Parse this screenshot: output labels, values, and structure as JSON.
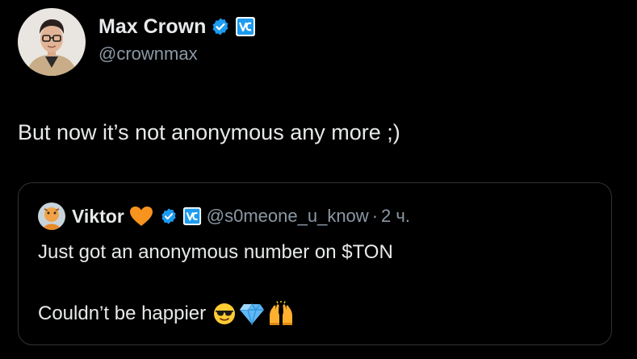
{
  "author": {
    "display_name": "Max Crown",
    "handle": "@crownmax",
    "avatar_icon": "profile-photo",
    "badges": [
      "verified-check-icon",
      "vc-badge-icon"
    ]
  },
  "tweet": {
    "text": "But now it’s not anonymous any more ;)"
  },
  "quoted": {
    "display_name": "Viktor",
    "handle": "@s0meone_u_know",
    "separator": "·",
    "time": "2 ч.",
    "line1": "Just got an anonymous number on $TON",
    "line2": "Couldn’t be happier",
    "emojis": [
      "sunglasses-emoji",
      "gem-emoji",
      "raised-hands-emoji"
    ]
  },
  "colors": {
    "background": "#000000",
    "text": "#e7e9ea",
    "secondary_text": "#8b98a5",
    "verified_blue": "#1d9bf0",
    "card_border": "#2f3336",
    "heart_orange": "#f7931e"
  }
}
